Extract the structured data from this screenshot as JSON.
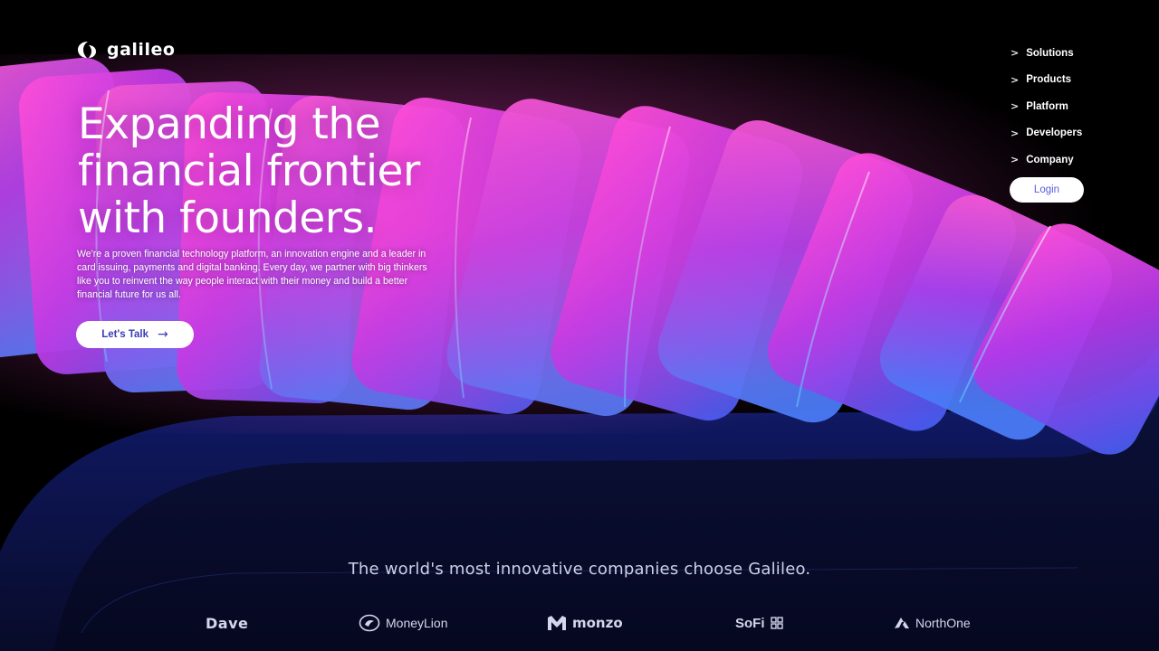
{
  "brand": {
    "name": "galileo",
    "logo_icon": "galileo-logo-icon"
  },
  "nav": {
    "items": [
      {
        "label": "Solutions",
        "icon": "chevron-right-icon"
      },
      {
        "label": "Products",
        "icon": "chevron-right-icon"
      },
      {
        "label": "Platform",
        "icon": "chevron-right-icon"
      },
      {
        "label": "Developers",
        "icon": "chevron-right-icon"
      },
      {
        "label": "Company",
        "icon": "chevron-right-icon"
      }
    ],
    "chevron": ">",
    "login_label": "Login"
  },
  "hero": {
    "headline_lines": [
      "Expanding the",
      "financial frontier",
      "with founders."
    ],
    "intro_lines": [
      "We're a proven financial technology platform, an innovation engine and a leader in",
      "card issuing, payments and digital banking. Every day, we partner with big thinkers",
      "like you to reinvent the way people interact with their money and build a better",
      "financial future for us all."
    ],
    "cta_label": "Let's Talk",
    "cta_arrow": "→",
    "cta_icon": "arrow-right-icon"
  },
  "clients": {
    "tagline": "The world's most innovative companies choose Galileo.",
    "logos": [
      {
        "name": "Dave",
        "text": "Dave",
        "icon": "dave-logo"
      },
      {
        "name": "MoneyLion",
        "text": "MoneyLion",
        "icon": "moneylion-logo-icon"
      },
      {
        "name": "monzo",
        "text": "monzo",
        "icon": "monzo-logo-icon"
      },
      {
        "name": "SoFi",
        "text": "SoFi",
        "icon": "sofi-logo-icon"
      },
      {
        "name": "NorthOne",
        "text": "NorthOne",
        "icon": "northone-logo-icon"
      }
    ]
  },
  "colors": {
    "background": "#000000",
    "lower_band": "#0d1340",
    "ribbon_magenta": "#e62fc8",
    "ribbon_violet": "#7a3cf0",
    "ribbon_blue": "#3f63ea",
    "cta_text": "#3b3bb8",
    "login_text": "#5a5ae0"
  }
}
